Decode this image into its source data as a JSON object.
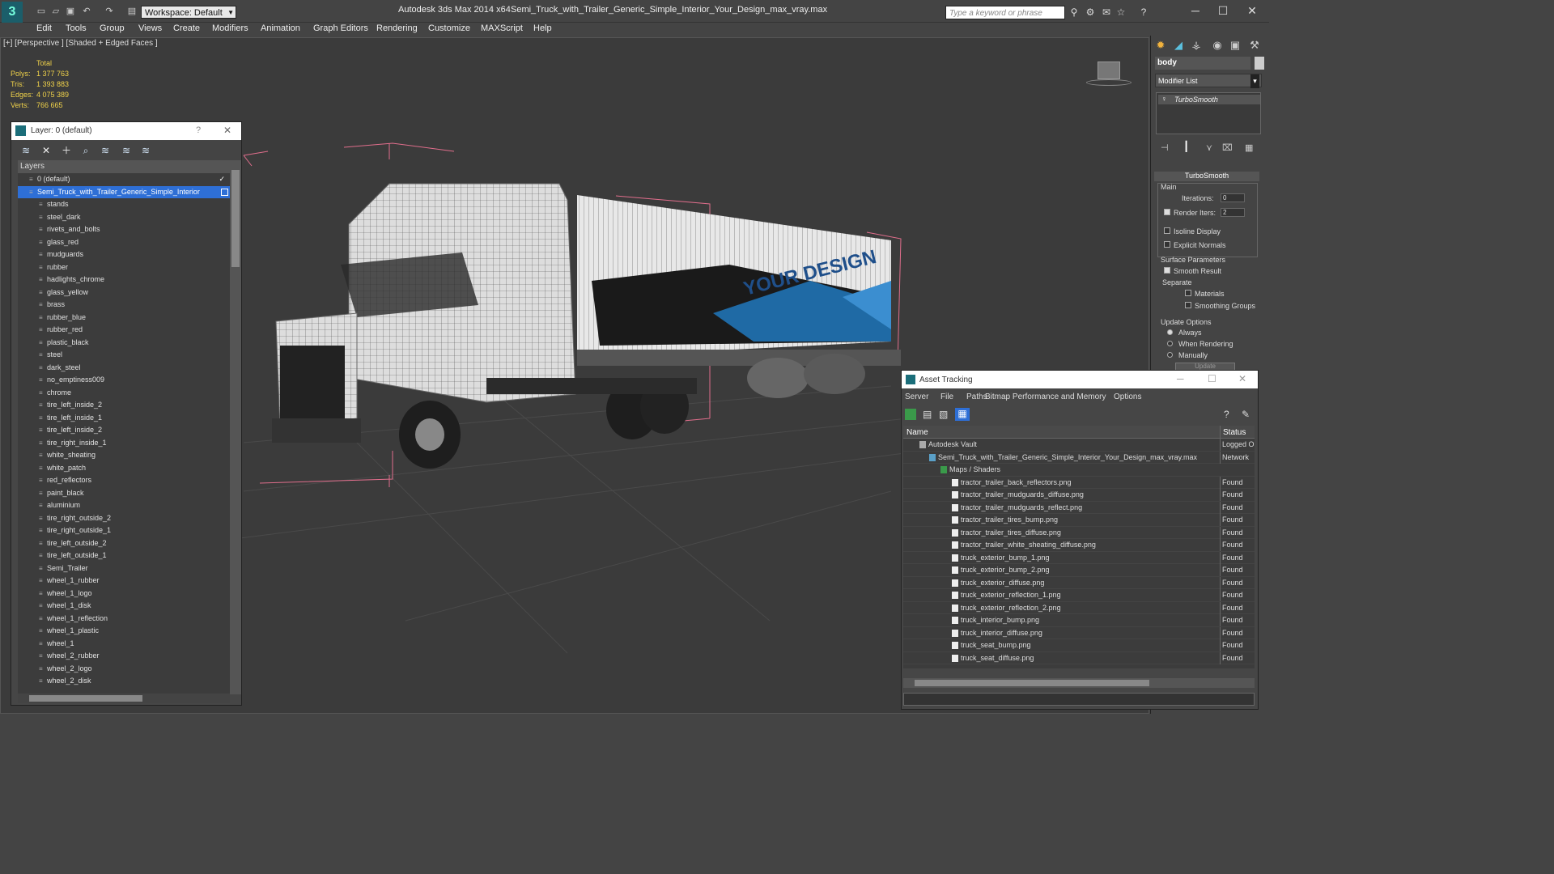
{
  "window": {
    "app_title": "Autodesk 3ds Max  2014 x64",
    "doc_title": "Semi_Truck_with_Trailer_Generic_Simple_Interior_Your_Design_max_vray.max",
    "workspace": "Workspace: Default",
    "search_placeholder": "Type a keyword or phrase"
  },
  "menu": [
    "Edit",
    "Tools",
    "Group",
    "Views",
    "Create",
    "Modifiers",
    "Animation",
    "Graph Editors",
    "Rendering",
    "Customize",
    "MAXScript",
    "Help"
  ],
  "viewport": {
    "label": "[+] [Perspective ] [Shaded + Edged Faces ]",
    "stats_header": "Total",
    "stats": [
      {
        "k": "Polys:",
        "v": "1 377 763"
      },
      {
        "k": "Tris:",
        "v": "1 393 883"
      },
      {
        "k": "Edges:",
        "v": "4 075 389"
      },
      {
        "k": "Verts:",
        "v": "766 665"
      }
    ],
    "trailer_text": "YOUR DESIGN"
  },
  "layer_panel": {
    "title": "Layer: 0 (default)",
    "help": "?",
    "column": "Layers",
    "rows": [
      {
        "label": "0 (default)",
        "indent": 0,
        "check": true
      },
      {
        "label": "Semi_Truck_with_Trailer_Generic_Simple_Interior",
        "indent": 0,
        "selected": true
      },
      {
        "label": "stands",
        "indent": 1
      },
      {
        "label": "steel_dark",
        "indent": 1
      },
      {
        "label": "rivets_and_bolts",
        "indent": 1
      },
      {
        "label": "glass_red",
        "indent": 1
      },
      {
        "label": "mudguards",
        "indent": 1
      },
      {
        "label": "rubber",
        "indent": 1
      },
      {
        "label": "hadlights_chrome",
        "indent": 1
      },
      {
        "label": "glass_yellow",
        "indent": 1
      },
      {
        "label": "brass",
        "indent": 1
      },
      {
        "label": "rubber_blue",
        "indent": 1
      },
      {
        "label": "rubber_red",
        "indent": 1
      },
      {
        "label": "plastic_black",
        "indent": 1
      },
      {
        "label": "steel",
        "indent": 1
      },
      {
        "label": "dark_steel",
        "indent": 1
      },
      {
        "label": "no_emptiness009",
        "indent": 1
      },
      {
        "label": "chrome",
        "indent": 1
      },
      {
        "label": "tire_left_inside_2",
        "indent": 1
      },
      {
        "label": "tire_left_inside_1",
        "indent": 1
      },
      {
        "label": "tire_left_inside_2",
        "indent": 1
      },
      {
        "label": "tire_right_inside_1",
        "indent": 1
      },
      {
        "label": "white_sheating",
        "indent": 1
      },
      {
        "label": "white_patch",
        "indent": 1
      },
      {
        "label": "red_reflectors",
        "indent": 1
      },
      {
        "label": "paint_black",
        "indent": 1
      },
      {
        "label": "aluminium",
        "indent": 1
      },
      {
        "label": "tire_right_outside_2",
        "indent": 1
      },
      {
        "label": "tire_right_outside_1",
        "indent": 1
      },
      {
        "label": "tire_left_outside_2",
        "indent": 1
      },
      {
        "label": "tire_left_outside_1",
        "indent": 1
      },
      {
        "label": "Semi_Trailer",
        "indent": 1
      },
      {
        "label": "wheel_1_rubber",
        "indent": 1
      },
      {
        "label": "wheel_1_logo",
        "indent": 1
      },
      {
        "label": "wheel_1_disk",
        "indent": 1
      },
      {
        "label": "wheel_1_reflection",
        "indent": 1
      },
      {
        "label": "wheel_1_plastic",
        "indent": 1
      },
      {
        "label": "wheel_1",
        "indent": 1
      },
      {
        "label": "wheel_2_rubber",
        "indent": 1
      },
      {
        "label": "wheel_2_logo",
        "indent": 1
      },
      {
        "label": "wheel_2_disk",
        "indent": 1
      }
    ]
  },
  "command_panel": {
    "object_name": "body",
    "modifier_list": "Modifier List",
    "stack_item": "TurboSmooth",
    "rollout": "TurboSmooth",
    "main": "Main",
    "iterations_label": "Iterations:",
    "iterations": "0",
    "render_iters_label": "Render Iters:",
    "render_iters": "2",
    "isoline": "Isoline Display",
    "explicit": "Explicit Normals",
    "surface": "Surface Parameters",
    "smooth_result": "Smooth Result",
    "separate": "Separate",
    "materials": "Materials",
    "smoothing_groups": "Smoothing Groups",
    "update_options": "Update Options",
    "always": "Always",
    "when_rendering": "When Rendering",
    "manually": "Manually",
    "update": "Update"
  },
  "asset_tracking": {
    "title": "Asset Tracking",
    "menu": [
      "Server",
      "File",
      "Paths",
      "Bitmap Performance and Memory",
      "Options"
    ],
    "col_name": "Name",
    "col_status": "Status",
    "rows": [
      {
        "name": "Autodesk Vault",
        "status": "Logged O",
        "level": 1,
        "type": "vault"
      },
      {
        "name": "Semi_Truck_with_Trailer_Generic_Simple_Interior_Your_Design_max_vray.max",
        "status": "Network",
        "level": 2,
        "type": "max"
      },
      {
        "name": "Maps / Shaders",
        "status": "",
        "level": 3,
        "type": "folder"
      },
      {
        "name": "tractor_trailer_back_reflectors.png",
        "status": "Found",
        "level": 4,
        "type": "file"
      },
      {
        "name": "tractor_trailer_mudguards_diffuse.png",
        "status": "Found",
        "level": 4,
        "type": "file"
      },
      {
        "name": "tractor_trailer_mudguards_reflect.png",
        "status": "Found",
        "level": 4,
        "type": "file"
      },
      {
        "name": "tractor_trailer_tires_bump.png",
        "status": "Found",
        "level": 4,
        "type": "file"
      },
      {
        "name": "tractor_trailer_tires_diffuse.png",
        "status": "Found",
        "level": 4,
        "type": "file"
      },
      {
        "name": "tractor_trailer_white_sheating_diffuse.png",
        "status": "Found",
        "level": 4,
        "type": "file"
      },
      {
        "name": "truck_exterior_bump_1.png",
        "status": "Found",
        "level": 4,
        "type": "file"
      },
      {
        "name": "truck_exterior_bump_2.png",
        "status": "Found",
        "level": 4,
        "type": "file"
      },
      {
        "name": "truck_exterior_diffuse.png",
        "status": "Found",
        "level": 4,
        "type": "file"
      },
      {
        "name": "truck_exterior_reflection_1.png",
        "status": "Found",
        "level": 4,
        "type": "file"
      },
      {
        "name": "truck_exterior_reflection_2.png",
        "status": "Found",
        "level": 4,
        "type": "file"
      },
      {
        "name": "truck_interior_bump.png",
        "status": "Found",
        "level": 4,
        "type": "file"
      },
      {
        "name": "truck_interior_diffuse.png",
        "status": "Found",
        "level": 4,
        "type": "file"
      },
      {
        "name": "truck_seat_bump.png",
        "status": "Found",
        "level": 4,
        "type": "file"
      },
      {
        "name": "truck_seat_diffuse.png",
        "status": "Found",
        "level": 4,
        "type": "file"
      }
    ]
  },
  "colors": {
    "accent_selection": "#2e6fd6",
    "stats_yellow": "#f0d24a",
    "trailer_blue": "#1f6aa5"
  }
}
